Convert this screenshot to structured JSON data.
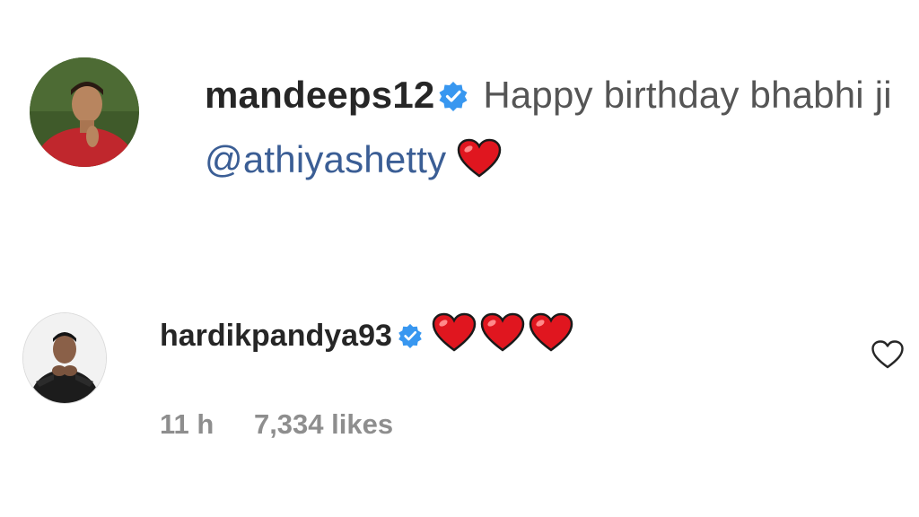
{
  "comments": [
    {
      "username": "mandeeps12",
      "verified": true,
      "text": "Happy birthday bhabhi ji",
      "mention": "@athiyashetty",
      "emoji": "red-heart"
    },
    {
      "username": "hardikpandya93",
      "verified": true,
      "emoji": [
        "red-heart",
        "red-heart",
        "red-heart"
      ],
      "time": "11 h",
      "likes": "7,334 likes"
    }
  ],
  "icons": {
    "verified": "verified-badge-icon",
    "heart_emoji": "red-heart-icon",
    "like": "heart-outline-icon"
  },
  "colors": {
    "verified_blue": "#3897f0",
    "mention": "#3b5e95",
    "heart_red": "#e0161f",
    "meta_gray": "#8e8e8e"
  }
}
